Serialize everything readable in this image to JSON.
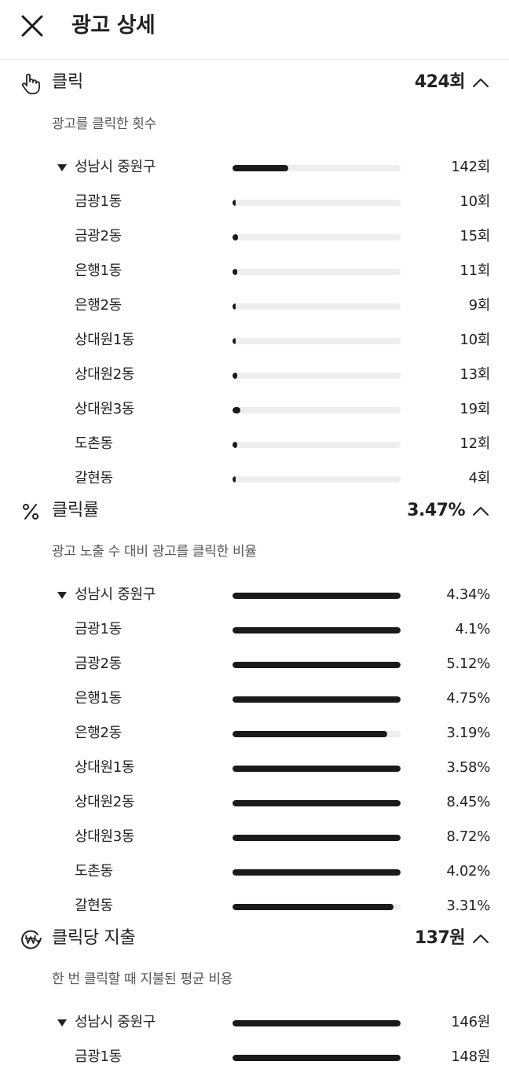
{
  "header": {
    "title": "광고 상세",
    "close_icon": "close-icon"
  },
  "sections": [
    {
      "id": "clicks",
      "icon": "hand-pointer-icon",
      "title": "클릭",
      "total": "424회",
      "description": "광고를 클릭한 횟수",
      "rows": [
        {
          "label": "성남시 중원구",
          "value": "142회",
          "level": 0.333,
          "parent": true
        },
        {
          "label": "금광1동",
          "value": "10회",
          "level": 0.02
        },
        {
          "label": "금광2동",
          "value": "15회",
          "level": 0.035
        },
        {
          "label": "은행1동",
          "value": "11회",
          "level": 0.026
        },
        {
          "label": "은행2동",
          "value": "9회",
          "level": 0.02
        },
        {
          "label": "상대원1동",
          "value": "10회",
          "level": 0.02
        },
        {
          "label": "상대원2동",
          "value": "13회",
          "level": 0.03
        },
        {
          "label": "상대원3동",
          "value": "19회",
          "level": 0.045
        },
        {
          "label": "도촌동",
          "value": "12회",
          "level": 0.028
        },
        {
          "label": "갈현동",
          "value": "4회",
          "level": 0.009
        }
      ]
    },
    {
      "id": "ctr",
      "icon": "percent-icon",
      "title": "클릭률",
      "total": "3.47%",
      "description": "광고 노출 수 대비 광고를 클릭한 비율",
      "rows": [
        {
          "label": "성남시 중원구",
          "value": "4.34%",
          "level": 1.0,
          "parent": true
        },
        {
          "label": "금광1동",
          "value": "4.1%",
          "level": 1.0
        },
        {
          "label": "금광2동",
          "value": "5.12%",
          "level": 1.0
        },
        {
          "label": "은행1동",
          "value": "4.75%",
          "level": 1.0
        },
        {
          "label": "은행2동",
          "value": "3.19%",
          "level": 0.92
        },
        {
          "label": "상대원1동",
          "value": "3.58%",
          "level": 1.0
        },
        {
          "label": "상대원2동",
          "value": "8.45%",
          "level": 1.0
        },
        {
          "label": "상대원3동",
          "value": "8.72%",
          "level": 1.0
        },
        {
          "label": "도촌동",
          "value": "4.02%",
          "level": 1.0
        },
        {
          "label": "갈현동",
          "value": "3.31%",
          "level": 0.96
        }
      ]
    },
    {
      "id": "cpc",
      "icon": "won-coin-icon",
      "title": "클릭당 지출",
      "total": "137원",
      "description": "한 번 클릭할 때 지불된 평균 비용",
      "rows": [
        {
          "label": "성남시 중원구",
          "value": "146원",
          "level": 1.0,
          "parent": true
        },
        {
          "label": "금광1동",
          "value": "148원",
          "level": 1.0
        }
      ]
    }
  ]
}
